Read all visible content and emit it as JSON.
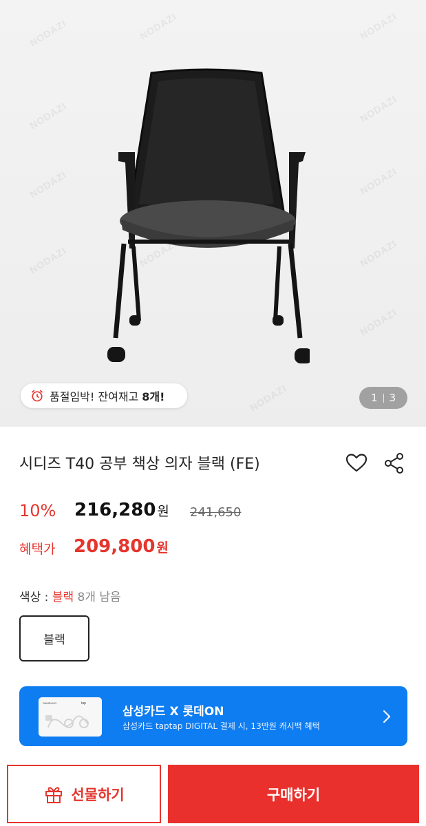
{
  "hero": {
    "watermark": "NODAZI",
    "stock_prefix": "품절임박! 잔여재고",
    "stock_count": "8개!",
    "pager_current": "1",
    "pager_total": "3"
  },
  "product": {
    "title": "시디즈 T40 공부 책상 의자 블랙 (FE)"
  },
  "price": {
    "discount_rate": "10%",
    "sale_price": "216,280",
    "currency": "원",
    "original_price": "241,650",
    "benefit_label": "혜택가",
    "benefit_price": "209,800"
  },
  "option": {
    "label": "색상 :",
    "selected": "블랙",
    "remaining": "8개 남음",
    "chip_label": "블랙"
  },
  "promo": {
    "title": "삼성카드 X 롯데ON",
    "subtitle": "삼성카드 taptap DIGITAL 결제 시, 13만원 캐시백 혜택",
    "bg_color": "#0f7df2"
  },
  "actions": {
    "gift_label": "선물하기",
    "buy_label": "구매하기",
    "accent_color": "#e5352d"
  },
  "icons": [
    "alarm-clock-icon",
    "heart-icon",
    "share-icon",
    "chevron-right-icon",
    "gift-icon"
  ]
}
